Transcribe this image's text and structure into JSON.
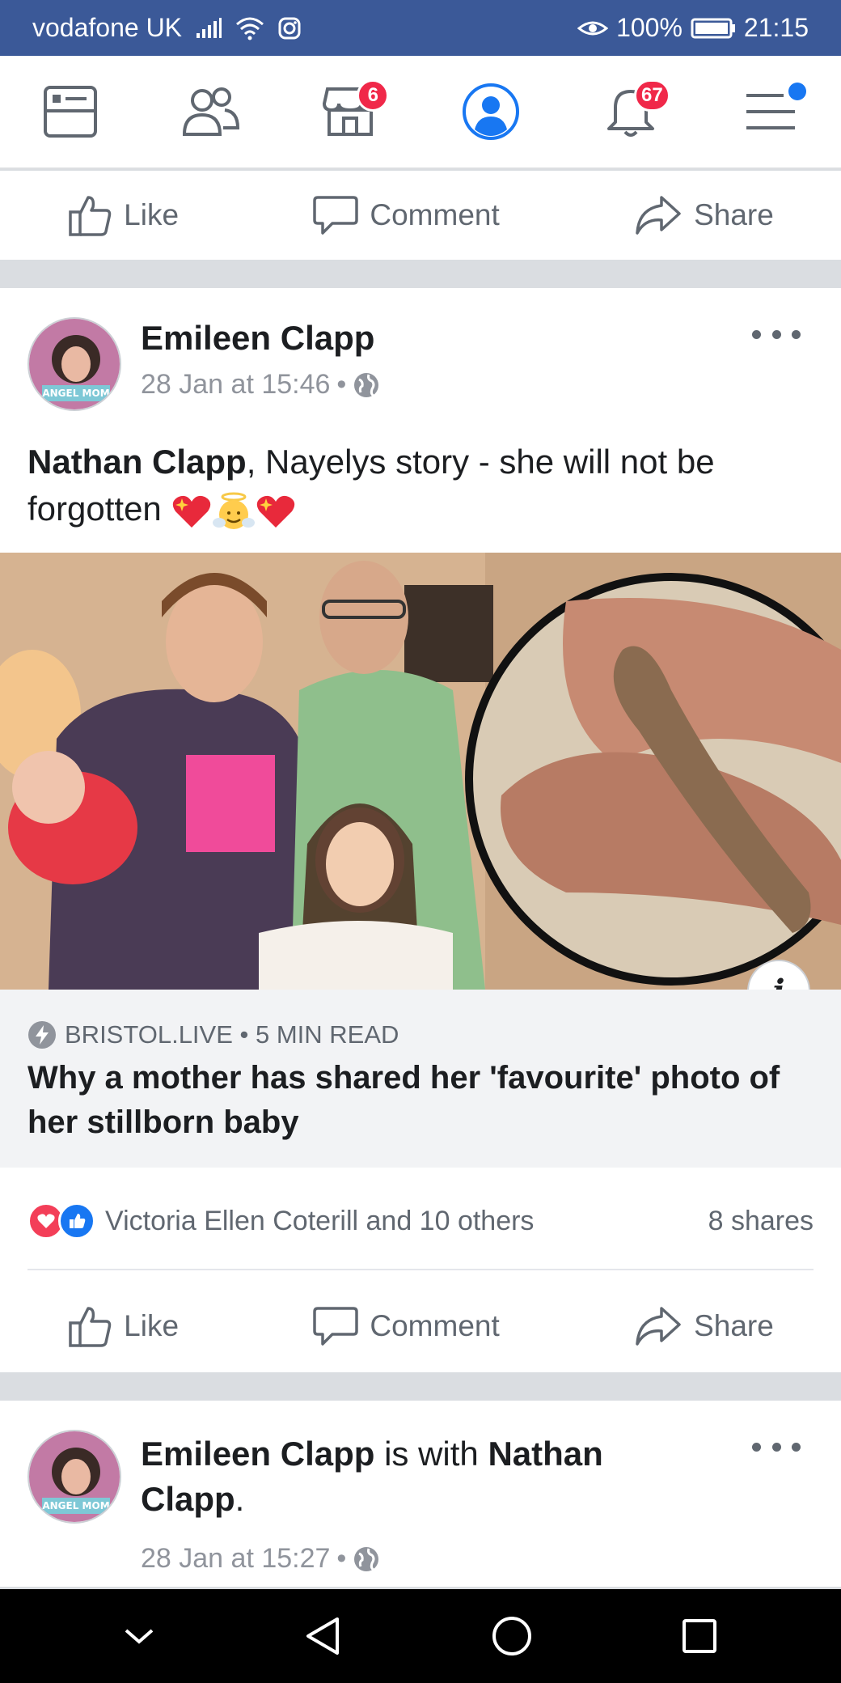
{
  "status": {
    "carrier": "vodafone UK",
    "battery": "100%",
    "time": "21:15"
  },
  "nav": {
    "marketplace_badge": "6",
    "notifications_badge": "67"
  },
  "actions": {
    "like": "Like",
    "comment": "Comment",
    "share": "Share"
  },
  "post1": {
    "author": "Emileen Clapp",
    "timestamp": "28 Jan at 15:46",
    "mention": "Nathan Clapp",
    "text": ", Nayelys story - she will not be forgotten",
    "avatar_caption": "ANGEL MOM",
    "link": {
      "source": "BRISTOL.LIVE • 5 MIN READ",
      "headline": "Why a mother has shared her 'favourite' photo of her stillborn baby",
      "info_icon": "i"
    },
    "reactions_text": "Victoria Ellen Coterill and 10 others",
    "shares": "8 shares"
  },
  "post2": {
    "author": "Emileen Clapp",
    "with_text": " is with ",
    "with_name": "Nathan",
    "with_name2": "Clapp",
    "period": ".",
    "timestamp": "28 Jan at 15:27",
    "avatar_caption": "ANGEL MOM"
  },
  "colors": {
    "status_bar": "#3b5998",
    "accent": "#1877f2",
    "badge": "#f02849",
    "love": "#f33e58"
  },
  "icons": [
    "news-feed-icon",
    "friends-icon",
    "marketplace-icon",
    "profile-icon",
    "bell-icon",
    "menu-icon",
    "like-icon",
    "comment-icon",
    "share-icon",
    "globe-icon",
    "more-icon",
    "lightning-icon",
    "love-reaction-icon",
    "like-reaction-icon",
    "back-icon",
    "home-icon",
    "recents-icon",
    "collapse-icon"
  ]
}
